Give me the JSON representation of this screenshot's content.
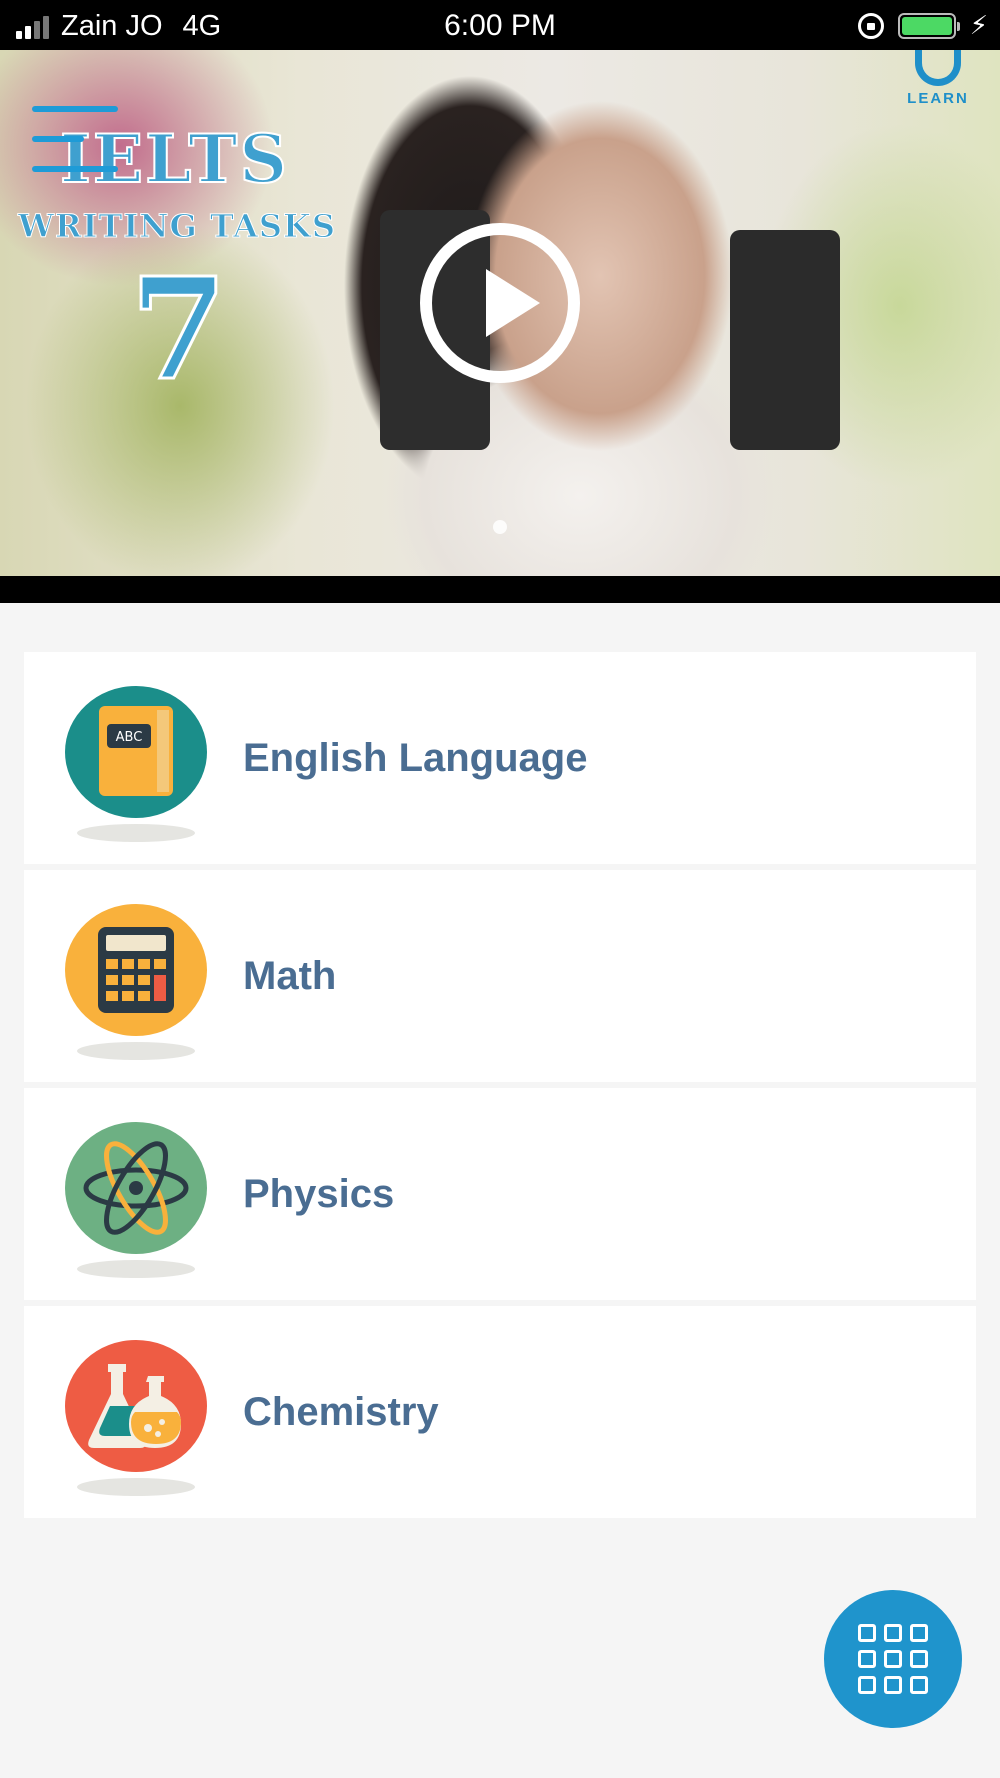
{
  "status_bar": {
    "carrier": "Zain JO",
    "network": "4G",
    "time": "6:00 PM"
  },
  "video": {
    "title_line1": "IELTS",
    "title_line2": "WRITING TASKS",
    "title_number": "7",
    "brand_logo": "LEARN"
  },
  "subjects": [
    {
      "label": "English Language",
      "icon": "abc-book-icon",
      "color": "#1b8e8a"
    },
    {
      "label": "Math",
      "icon": "calculator-icon",
      "color": "#f9b13c"
    },
    {
      "label": "Physics",
      "icon": "atom-icon",
      "color": "#6db083"
    },
    {
      "label": "Chemistry",
      "icon": "flask-icon",
      "color": "#ee5c44"
    }
  ],
  "colors": {
    "accent": "#1f94cc",
    "label_text": "#4a6d92",
    "background": "#f5f5f5"
  },
  "fab": {
    "icon": "grid-icon"
  }
}
